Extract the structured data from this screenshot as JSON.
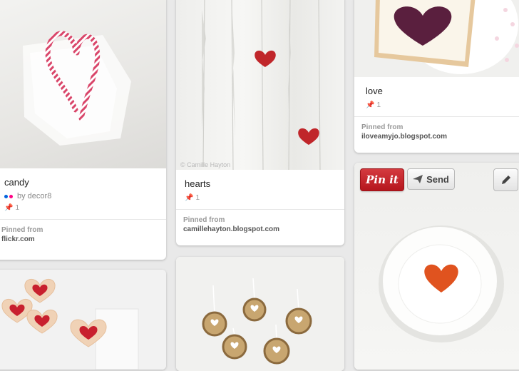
{
  "pins": [
    {
      "id": "candy",
      "description": "candy",
      "by_text": "by decor8",
      "repins": "1",
      "pinned_from_label": "Pinned from",
      "source_domain": "flickr.com"
    },
    {
      "id": "hearts",
      "description": "hearts",
      "watermark": "© Camille Hayton",
      "repins": "1",
      "pinned_from_label": "Pinned from",
      "source_domain": "camillehayton.blogspot.com"
    },
    {
      "id": "love",
      "description": "love",
      "repins": "1",
      "pinned_from_label": "Pinned from",
      "source_domain": "iloveamyjo.blogspot.com"
    }
  ],
  "hover_actions": {
    "pinit_label": "Pin it",
    "send_label": "Send",
    "edit_icon": "pencil-icon"
  },
  "colors": {
    "background": "#e9e9e9",
    "pinit_red": "#c8232c",
    "flickr_blue": "#0063dc",
    "flickr_pink": "#ff0084"
  }
}
